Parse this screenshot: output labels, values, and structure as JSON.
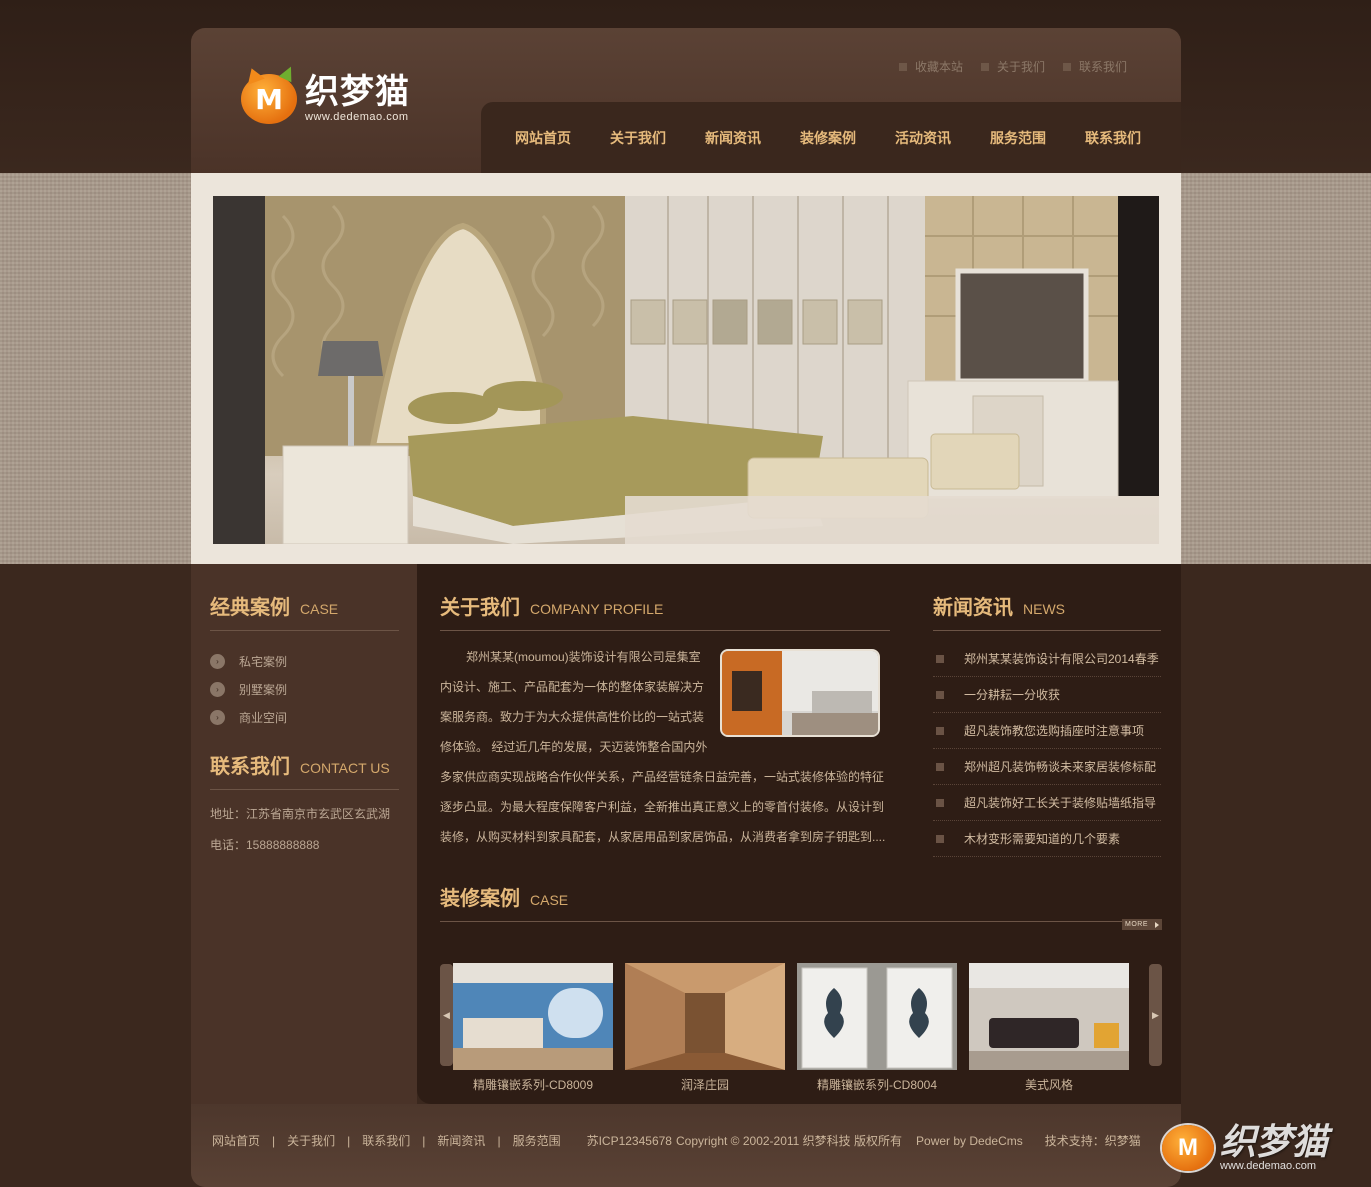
{
  "site": {
    "logo_cn": "织梦猫",
    "logo_url": "www.dedemao.com",
    "logo_mark": "M"
  },
  "toplinks": [
    "收藏本站",
    "关于我们",
    "联系我们"
  ],
  "nav": [
    "网站首页",
    "关于我们",
    "新闻资讯",
    "装修案例",
    "活动资讯",
    "服务范围",
    "联系我们"
  ],
  "case_section": {
    "title_cn": "经典案例",
    "title_en": "CASE",
    "items": [
      "私宅案例",
      "别墅案例",
      "商业空间"
    ]
  },
  "contact_section": {
    "title_cn": "联系我们",
    "title_en": "CONTACT US",
    "address": "地址：江苏省南京市玄武区玄武湖",
    "phone": "电话：15888888888"
  },
  "about_section": {
    "title_cn": "关于我们",
    "title_en": "COMPANY PROFILE",
    "lines": [
      "郑州某某(moumou)装饰设计有限公司是集室",
      "内设计、施工、产品配套为一体的整体家装解决方",
      "案服务商。致力于为大众提供高性价比的一站式装",
      "修体验。 经过近几年的发展，天迈装饰整合国内外",
      "多家供应商实现战略合作伙伴关系，产品经营链条日益完善，一站式装修体验的特征",
      "逐步凸显。为最大程度保障客户利益，全新推出真正意义上的零首付装修。从设计到",
      "装修，从购买材料到家具配套，从家居用品到家居饰品，从消费者拿到房子钥匙到...."
    ]
  },
  "news_section": {
    "title_cn": "新闻资讯",
    "title_en": "NEWS",
    "items": [
      "郑州某某装饰设计有限公司2014春季",
      "一分耕耘一分收获",
      "超凡装饰教您选购插座时注意事项",
      "郑州超凡装饰畅谈未来家居装修标配",
      "超凡装饰好工长关于装修贴墙纸指导",
      "木材变形需要知道的几个要素"
    ]
  },
  "gallery_section": {
    "title_cn": "装修案例",
    "title_en": "CASE",
    "more_label": "MORE",
    "prev_icon": "◀",
    "next_icon": "▶",
    "items": [
      "精雕镶嵌系列-CD8009",
      "润泽庄园",
      "精雕镶嵌系列-CD8004",
      "美式风格"
    ]
  },
  "footer": {
    "links": [
      "网站首页",
      "关于我们",
      "联系我们",
      "新闻资讯",
      "服务范围"
    ],
    "separator": "|",
    "icp": "苏ICP12345678",
    "copyright": "Copyright © 2002-2011 织梦科技 版权所有",
    "power": "Power by DedeCms",
    "support": "技术支持：织梦猫"
  },
  "watermark": {
    "cn": "织梦猫",
    "url": "www.dedemao.com",
    "mark": "M"
  },
  "colors": {
    "accent": "#e6ba7c",
    "page_bg": "#3a271d",
    "banner_frame": "#ece5db"
  }
}
